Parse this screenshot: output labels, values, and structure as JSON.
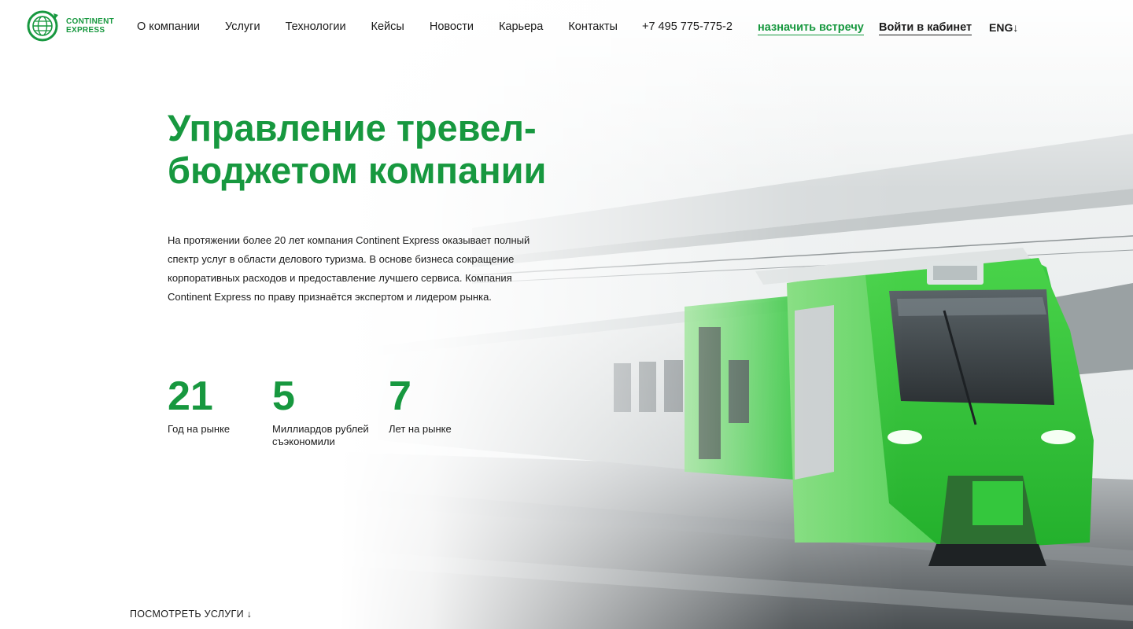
{
  "brand": {
    "logo_line1": "CONTINENT",
    "logo_line2": "EXPRESS",
    "accent_color": "#17983f"
  },
  "nav": {
    "items": [
      {
        "label": "О компании"
      },
      {
        "label": "Услуги"
      },
      {
        "label": "Технологии"
      },
      {
        "label": "Кейсы"
      },
      {
        "label": "Новости"
      },
      {
        "label": "Карьера"
      },
      {
        "label": "Контакты"
      }
    ],
    "phone": "+7 495 775-775-2",
    "meet_label": "назначить встречу",
    "login_label": "Войти в кабинет",
    "lang_label": "ENG↓"
  },
  "hero": {
    "title_line1": "Управление тревел-",
    "title_line2": "бюджетом компании",
    "description": "На протяжении более 20 лет компания Continent Express оказывает полный спектр услуг в области делового туризма. В основе бизнеса сокращение корпоративных расходов и предоставление лучшего сервиса. Компания Continent Express по праву признаётся экспертом и лидером рынка.",
    "background_icon": "green-train-photo"
  },
  "stats": [
    {
      "value": "21",
      "label": "Год на рынке"
    },
    {
      "value": "5",
      "label": "Миллиардов рублей съэкономили"
    },
    {
      "value": "7",
      "label": "Лет на рынке"
    }
  ],
  "scroll_hint": "ПОСМОТРЕТЬ УСЛУГИ ↓"
}
